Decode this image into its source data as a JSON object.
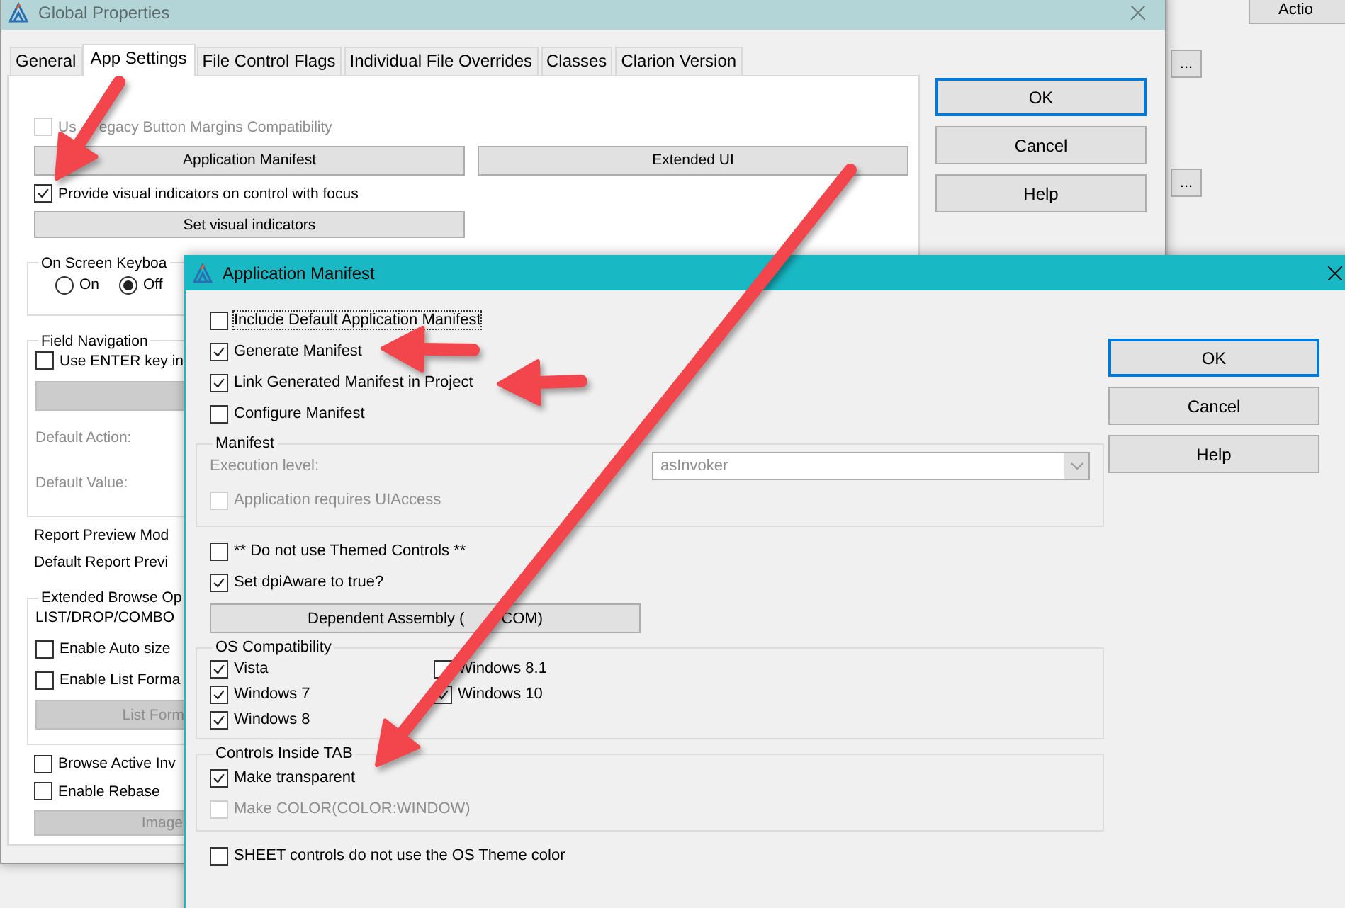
{
  "back_window": {
    "title": "Global Properties",
    "tabs": [
      {
        "label": "General",
        "selected": false
      },
      {
        "label": "App Settings",
        "selected": true
      },
      {
        "label": "File Control Flags",
        "selected": false
      },
      {
        "label": "Individual File Overrides",
        "selected": false
      },
      {
        "label": "Classes",
        "selected": false
      },
      {
        "label": "Clarion Version",
        "selected": false
      }
    ],
    "content": [
      {
        "kind": "checkbox",
        "label_parts": [
          "Us",
          "egacy Button Margins Compatibility"
        ],
        "checked": false,
        "disabled": true
      },
      {
        "kind": "button_row",
        "buttons": [
          "Application Manifest",
          "Extended UI"
        ]
      },
      {
        "kind": "checkbox",
        "label": "Provide visual indicators on control with focus",
        "checked": true,
        "disabled": false
      },
      {
        "kind": "button",
        "label": "Set visual indicators",
        "disabled": false
      },
      {
        "kind": "group",
        "title": "On Screen Keyboa",
        "items": [
          {
            "kind": "radios",
            "options": [
              {
                "label": "On",
                "selected": false
              },
              {
                "label": "Off",
                "selected": true
              }
            ]
          }
        ]
      },
      {
        "kind": "group",
        "title": "Field Navigation",
        "items": [
          {
            "kind": "checkbox",
            "label": "Use ENTER key in",
            "checked": false,
            "disabled": false
          },
          {
            "kind": "button",
            "disabled": true
          },
          {
            "kind": "label",
            "label": "Default Action:",
            "disabled": true
          },
          {
            "kind": "label",
            "label": "Default Value:",
            "disabled": true
          }
        ]
      },
      {
        "kind": "label",
        "label": "Report Preview Mod",
        "disabled": false
      },
      {
        "kind": "label",
        "label": "Default Report Previ",
        "disabled": false
      },
      {
        "kind": "group",
        "title": "Extended Browse Op",
        "items": [
          {
            "kind": "label",
            "label": "LIST/DROP/COMBO",
            "disabled": false
          },
          {
            "kind": "checkbox",
            "label": "Enable Auto size",
            "checked": false,
            "disabled": false
          },
          {
            "kind": "checkbox",
            "label": "Enable List Forma",
            "checked": false,
            "disabled": false
          },
          {
            "kind": "button",
            "label": "List Form",
            "disabled": true
          }
        ]
      },
      {
        "kind": "checkbox",
        "label": "Browse Active Inv",
        "checked": false,
        "disabled": false
      },
      {
        "kind": "checkbox",
        "label": "Enable Rebase",
        "checked": false,
        "disabled": false
      },
      {
        "kind": "button",
        "label": "Image",
        "disabled": true
      }
    ],
    "buttons": [
      {
        "label": "OK",
        "default": true
      },
      {
        "label": "Cancel",
        "default": false
      },
      {
        "label": "Help",
        "default": false
      }
    ]
  },
  "side_window": {
    "top_button": "Actio",
    "buttons": [
      "...",
      "..."
    ]
  },
  "dialog": {
    "title": "Application Manifest",
    "options": [
      {
        "label": "Include Default Application Manifest",
        "checked": false,
        "focused": true,
        "disabled": false
      },
      {
        "label": "Generate Manifest",
        "checked": true,
        "focused": false,
        "disabled": false
      },
      {
        "label": "Link Generated Manifest in Project",
        "checked": true,
        "focused": false,
        "disabled": false
      },
      {
        "label": "Configure Manifest",
        "checked": false,
        "focused": false,
        "disabled": false
      }
    ],
    "manifest_group": {
      "title": "Manifest",
      "execution_label": "Execution level:",
      "execution_value": "asInvoker",
      "disabled": true,
      "uiaccess": {
        "label": "Application requires UIAccess",
        "checked": false,
        "focused": false,
        "disabled": true
      }
    },
    "options_2": [
      {
        "label": "** Do not use Themed Controls **",
        "checked": false,
        "focused": false,
        "disabled": false
      },
      {
        "label": "Set dpiAware to true?",
        "checked": true,
        "focused": false,
        "disabled": false
      }
    ],
    "assembly_button": [
      "Dependent Assembly (",
      "COM)"
    ],
    "os_group": {
      "title": "OS Compatibility",
      "columns": [
        [
          {
            "label": "Vista",
            "checked": true,
            "focused": false,
            "disabled": false
          },
          {
            "label": "Windows 7",
            "checked": true,
            "focused": false,
            "disabled": false
          },
          {
            "label": "Windows 8",
            "checked": true,
            "focused": false,
            "disabled": false
          }
        ],
        [
          {
            "label": "Windows 8.1",
            "checked": false,
            "focused": false,
            "disabled": false
          },
          {
            "label": "Windows 10",
            "checked": true,
            "focused": false,
            "disabled": false
          }
        ]
      ]
    },
    "tab_group": {
      "title": "Controls Inside TAB",
      "items": [
        {
          "label": "Make transparent",
          "checked": true,
          "focused": false,
          "disabled": false
        },
        {
          "label": "Make COLOR(COLOR:WINDOW)",
          "checked": false,
          "focused": false,
          "disabled": true
        }
      ]
    },
    "sheet_option": {
      "label": "SHEET controls do not use the OS Theme color",
      "checked": false,
      "focused": false,
      "disabled": false
    },
    "buttons": [
      {
        "label": "OK",
        "default": true
      },
      {
        "label": "Cancel",
        "default": false
      },
      {
        "label": "Help",
        "default": false
      }
    ]
  }
}
